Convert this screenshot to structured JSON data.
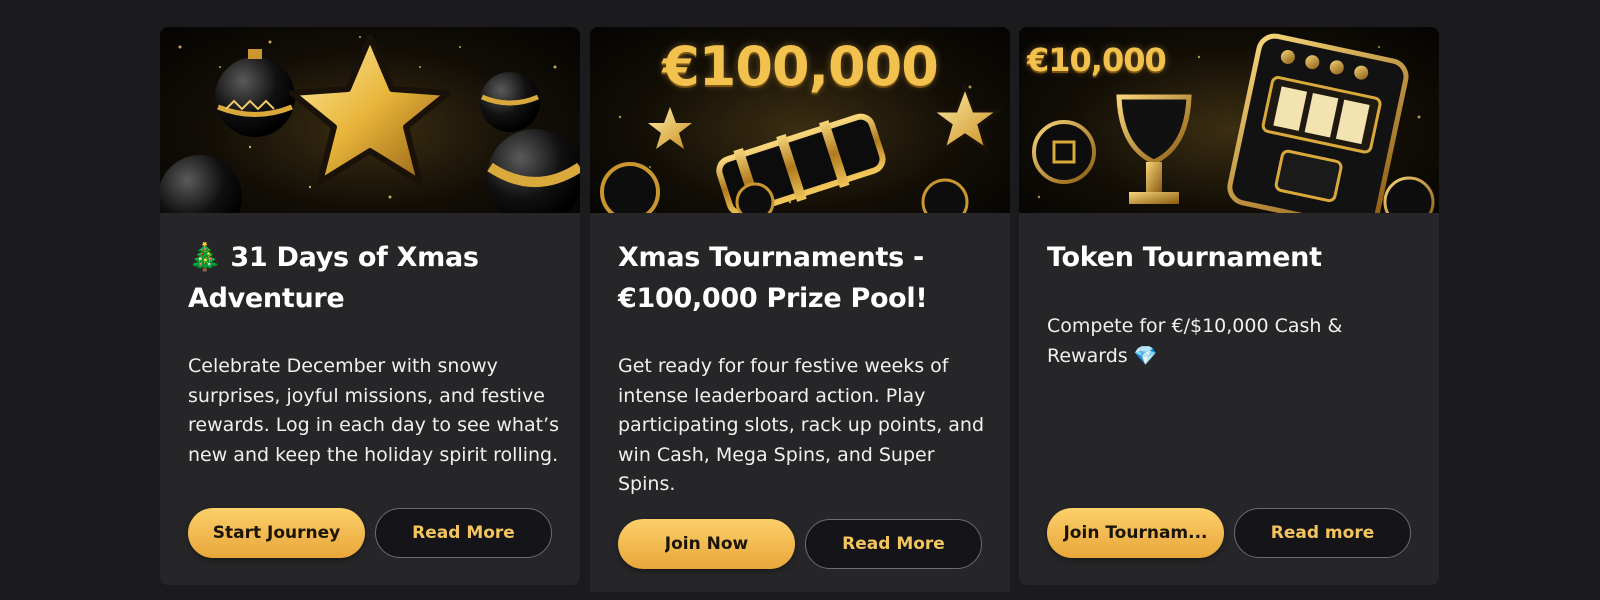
{
  "cards": [
    {
      "banner_icons": [
        "christmas-ornament-icon",
        "star-icon",
        "sparkles-icon"
      ],
      "title": "🎄 31 Days of Xmas Adventure",
      "description": "Celebrate December with snowy surprises, joyful missions, and festive rewards. Log in each day to see what’s new and keep the holiday spirit rolling.",
      "primary_label": "Start Journey",
      "secondary_label": "Read More"
    },
    {
      "banner_amount": "€100,000",
      "banner_icons": [
        "slot-reel-icon",
        "star-icon",
        "christmas-ornament-icon",
        "casino-chip-icon"
      ],
      "title": "Xmas Tournaments - €100,000 Prize Pool!",
      "description": "Get ready for four festive weeks of intense leaderboard action. Play participating slots, rack up points, and win Cash, Mega Spins, and Super Spins.",
      "primary_label": "Join Now",
      "secondary_label": "Read More"
    },
    {
      "banner_amount": "€10,000",
      "banner_icons": [
        "trophy-icon",
        "slot-machine-icon",
        "token-coin-icon"
      ],
      "title": "Token Tournament",
      "description": "Compete for €/$10,000 Cash & Rewards 💎",
      "primary_label": "Join Tournam...",
      "secondary_label": "Read more"
    }
  ],
  "colors": {
    "page_background": "#1b1b1d",
    "card_background": "#262628",
    "primary_button": "#f3b548",
    "secondary_button_text": "#f3c55f"
  }
}
